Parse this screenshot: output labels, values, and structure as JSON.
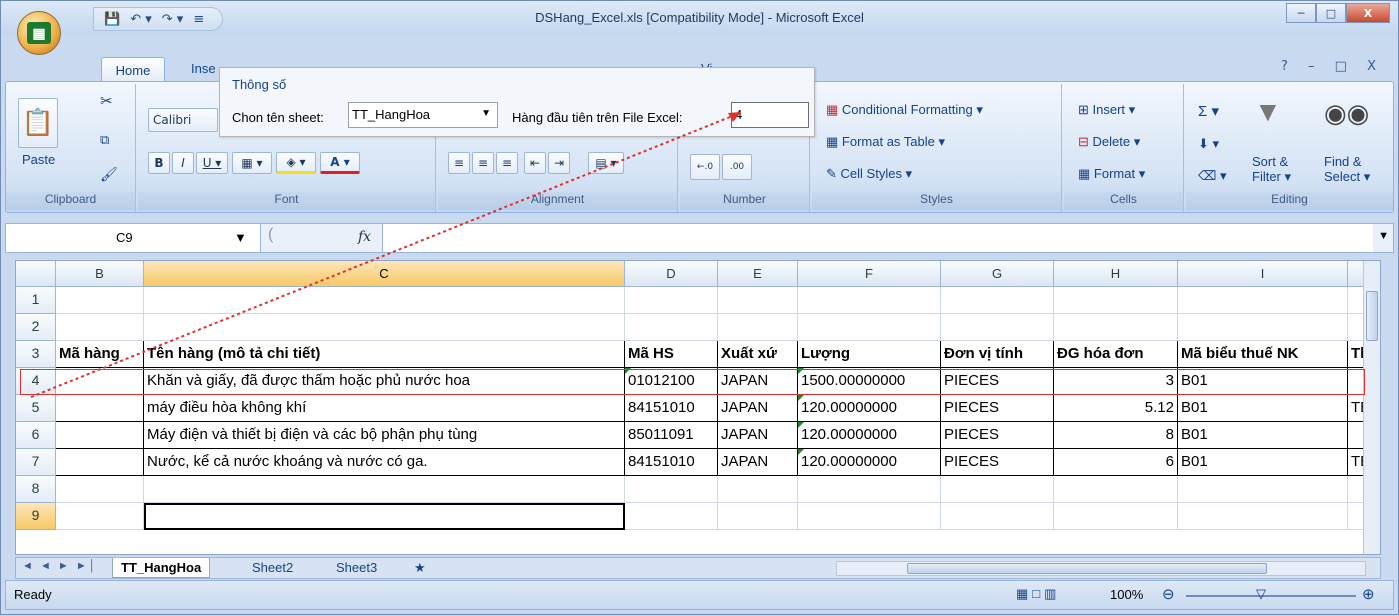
{
  "window": {
    "title": "DSHang_Excel.xls  [Compatibility Mode] - Microsoft Excel",
    "qat_icons": [
      "save-icon",
      "undo-icon",
      "redo-icon",
      "customize-icon"
    ],
    "min_label": "─",
    "max_label": "□",
    "close_label": "X"
  },
  "ribbon": {
    "tabs": [
      "Home",
      "Inse",
      "View"
    ],
    "active_tab": "Home",
    "help_glyphs": "? – □ X",
    "clipboard": {
      "paste": "Paste",
      "label": "Clipboard"
    },
    "font": {
      "name": "Calibri",
      "label": "Font"
    },
    "alignment": {
      "label": "Alignment"
    },
    "number": {
      "label": "Number",
      "inc": "←.0 .00",
      "dec": ".00 →.0"
    },
    "styles": {
      "conditional": "Conditional Formatting ▾",
      "format_table": "Format as Table ▾",
      "cell_styles": "Cell Styles ▾",
      "label": "Styles"
    },
    "cells": {
      "insert": "Insert ▾",
      "delete": "Delete ▾",
      "format": "Format ▾",
      "label": "Cells"
    },
    "editing": {
      "sigma": "Σ ▾",
      "sort1": "Sort &",
      "sort2": "Filter ▾",
      "find1": "Find &",
      "find2": "Select ▾",
      "label": "Editing"
    }
  },
  "formula_bar": {
    "cell_ref": "C9",
    "fx": "fx",
    "value": ""
  },
  "dialog": {
    "title": "Thông số",
    "sheet_label": "Chon tên sheet:",
    "sheet_value": "TT_HangHoa",
    "row_label": "Hàng đầu tiên trên File Excel:",
    "row_value": "4"
  },
  "grid": {
    "columns": [
      "B",
      "C",
      "D",
      "E",
      "F",
      "G",
      "H",
      "I",
      ""
    ],
    "selected_column": "C",
    "header_row": [
      "Mã hàng",
      "Tên hàng (mô tả chi tiết)",
      "Mã HS",
      "Xuất xứ",
      "Lượng",
      "Đơn vị tính",
      "ĐG hóa đơn",
      "Mã biểu thuế NK",
      "Th"
    ],
    "rows": [
      {
        "n": "1",
        "cells": [
          "",
          "",
          "",
          "",
          "",
          "",
          "",
          "",
          ""
        ]
      },
      {
        "n": "2",
        "cells": [
          "",
          "",
          "",
          "",
          "",
          "",
          "",
          "",
          ""
        ]
      },
      {
        "n": "4",
        "cells": [
          "",
          "Khăn và giấy, đã được thấm hoặc phủ nước hoa",
          "01012100",
          "JAPAN",
          "1500.00000000",
          "PIECES",
          "3",
          "B01",
          ""
        ]
      },
      {
        "n": "5",
        "cells": [
          "",
          "máy điều hòa không khí",
          "84151010",
          "JAPAN",
          "120.00000000",
          "PIECES",
          "5.12",
          "B01",
          "TE"
        ]
      },
      {
        "n": "6",
        "cells": [
          "",
          "Máy điện và thiết bị điện và các bộ phận  phụ tùng",
          "85011091",
          "JAPAN",
          "120.00000000",
          "PIECES",
          "8",
          "B01",
          ""
        ]
      },
      {
        "n": "7",
        "cells": [
          "",
          "Nước, kể cả nước khoáng và nước có ga.",
          "84151010",
          "JAPAN",
          "120.00000000",
          "PIECES",
          "6",
          "B01",
          "TE"
        ]
      },
      {
        "n": "8",
        "cells": [
          "",
          "",
          "",
          "",
          "",
          "",
          "",
          "",
          ""
        ]
      },
      {
        "n": "9",
        "cells": [
          "",
          "",
          "",
          "",
          "",
          "",
          "",
          "",
          ""
        ]
      }
    ],
    "header_row_number": "3"
  },
  "sheets": {
    "tabs": [
      "TT_HangHoa",
      "Sheet2",
      "Sheet3"
    ],
    "active": "TT_HangHoa",
    "nav": "◄ ◄ ► ►│"
  },
  "status": {
    "ready": "Ready",
    "zoom": "100%"
  },
  "colors": {
    "accent": "#15428b",
    "highlight": "#e03030",
    "ribbon": "#d6e4f5"
  }
}
